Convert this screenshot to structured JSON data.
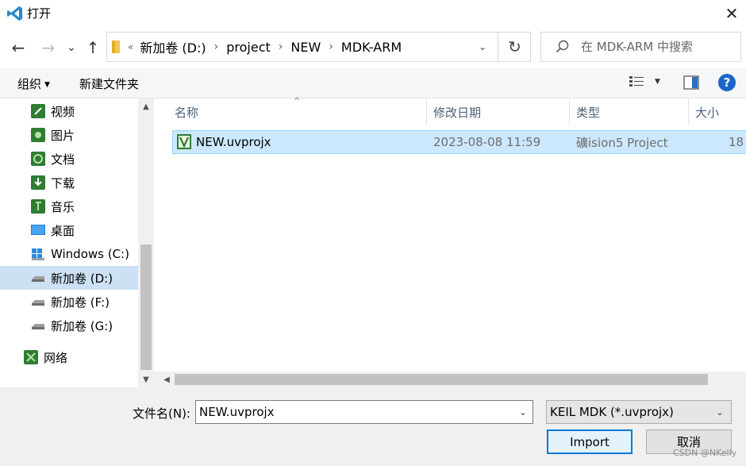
{
  "window": {
    "title": "打开",
    "close_glyph": "✕"
  },
  "nav": {
    "back_glyph": "←",
    "forward_glyph": "→",
    "recent_glyph": "⌄",
    "up_glyph": "↑",
    "refresh_glyph": "↻"
  },
  "address": {
    "chevron": "«",
    "crumbs": [
      "新加卷 (D:)",
      "project",
      "NEW",
      "MDK-ARM"
    ],
    "separator": "›",
    "dropdown_glyph": "⌄"
  },
  "search": {
    "placeholder": "在 MDK-ARM 中搜索"
  },
  "toolbar": {
    "organize": "组织",
    "organize_caret": "▼",
    "new_folder": "新建文件夹",
    "view_caret": "▼",
    "help": "?"
  },
  "sidebar": {
    "items": [
      {
        "label": "视频",
        "icon": "video-icon"
      },
      {
        "label": "图片",
        "icon": "pictures-icon"
      },
      {
        "label": "文档",
        "icon": "documents-icon"
      },
      {
        "label": "下载",
        "icon": "downloads-icon"
      },
      {
        "label": "音乐",
        "icon": "music-icon"
      },
      {
        "label": "桌面",
        "icon": "desktop-icon"
      },
      {
        "label": "Windows (C:)",
        "icon": "windows-drive-icon"
      },
      {
        "label": "新加卷 (D:)",
        "icon": "drive-icon",
        "selected": true
      },
      {
        "label": "新加卷 (F:)",
        "icon": "drive-icon"
      },
      {
        "label": "新加卷 (G:)",
        "icon": "drive-icon"
      },
      {
        "label": "网络",
        "icon": "network-icon"
      }
    ],
    "scroll_up": "▲",
    "scroll_down": "▼"
  },
  "file_list": {
    "columns": [
      "名称",
      "修改日期",
      "类型",
      "大小"
    ],
    "sort_glyph": "^",
    "rows": [
      {
        "name": "NEW.uvprojx",
        "modified": "2023-08-08 11:59",
        "type": "礦ision5 Project",
        "size": "18"
      }
    ],
    "scroll_left": "◀"
  },
  "footer": {
    "filename_label": "文件名(N):",
    "filename_value": "NEW.uvprojx",
    "filetype_value": "KEIL MDK (*.uvprojx)",
    "dropdown_glyph": "⌄",
    "import_button": "Import",
    "cancel_button": "取消",
    "watermark": "CSDN @NKelly"
  },
  "colors": {
    "accent": "#0078d7",
    "selection": "#cce8ff",
    "nav_selection": "#cce1f4",
    "help_blue": "#1b65c8",
    "icon_green": "#3a9a3a"
  }
}
